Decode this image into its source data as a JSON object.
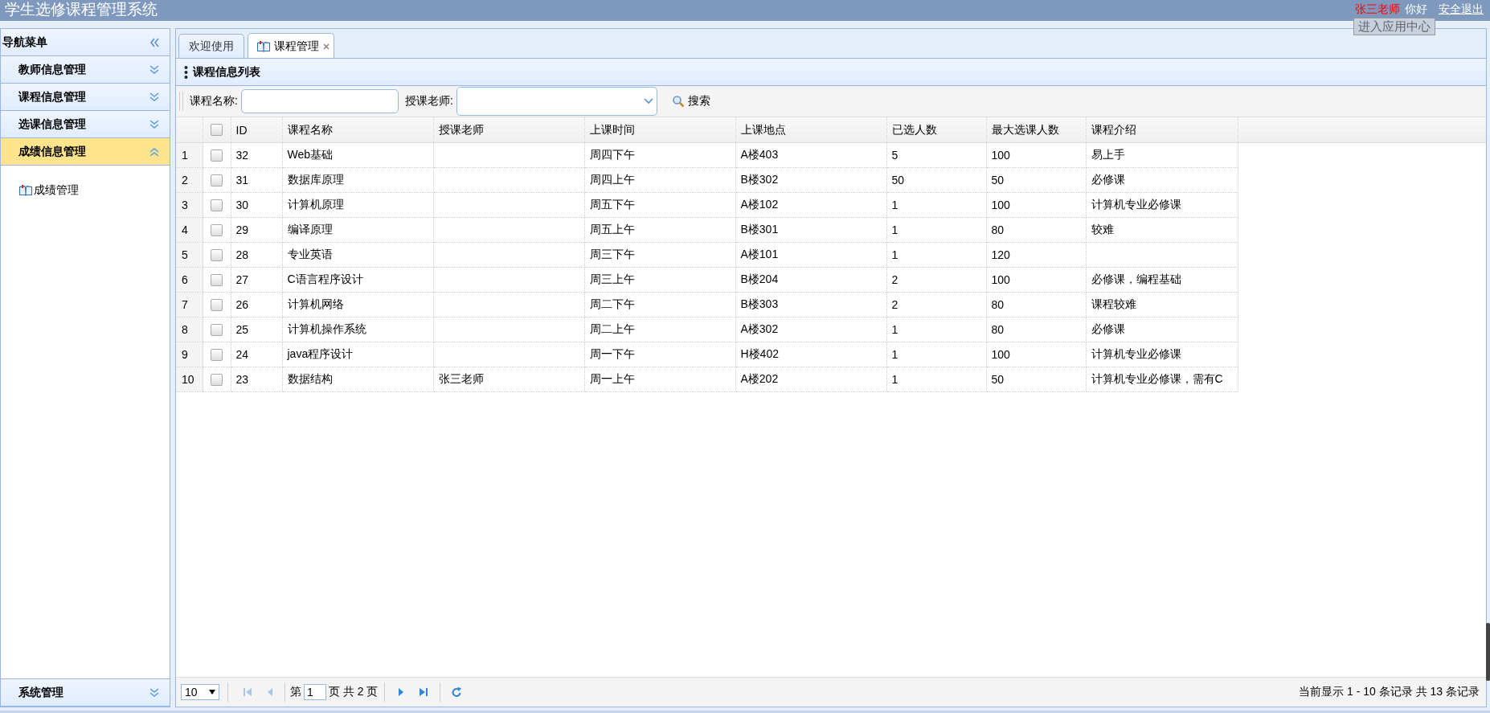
{
  "header": {
    "title": "学生选修课程管理系统",
    "user": "张三老师",
    "greeting": "你好",
    "logout": "安全退出",
    "tooltip": "进入应用中心"
  },
  "sidebar": {
    "title": "导航菜单",
    "items": [
      {
        "label": "教师信息管理",
        "selected": false,
        "expanded": false
      },
      {
        "label": "课程信息管理",
        "selected": false,
        "expanded": false
      },
      {
        "label": "选课信息管理",
        "selected": false,
        "expanded": false
      },
      {
        "label": "成绩信息管理",
        "selected": true,
        "expanded": true,
        "children": [
          {
            "label": "成绩管理"
          }
        ]
      },
      {
        "label": "系统管理",
        "selected": false,
        "expanded": false
      }
    ]
  },
  "tabs": [
    {
      "label": "欢迎使用",
      "selected": false,
      "closable": false
    },
    {
      "label": "课程管理",
      "selected": true,
      "closable": true
    }
  ],
  "panel": {
    "title": "课程信息列表"
  },
  "search": {
    "name_label": "课程名称:",
    "teacher_label": "授课老师:",
    "button": "搜索"
  },
  "table": {
    "header_checked": false,
    "columns": [
      "ID",
      "课程名称",
      "授课老师",
      "上课时间",
      "上课地点",
      "已选人数",
      "最大选课人数",
      "课程介绍"
    ],
    "rows": [
      {
        "number": "1",
        "checked": false,
        "cells": [
          "32",
          "Web基础",
          null,
          "周四下午",
          "A楼403",
          "5",
          "100",
          "易上手"
        ]
      },
      {
        "number": "2",
        "checked": false,
        "cells": [
          "31",
          "数据库原理",
          null,
          "周四上午",
          "B楼302",
          "50",
          "50",
          "必修课"
        ]
      },
      {
        "number": "3",
        "checked": false,
        "cells": [
          "30",
          "计算机原理",
          null,
          "周五下午",
          "A楼102",
          "1",
          "100",
          "计算机专业必修课"
        ]
      },
      {
        "number": "4",
        "checked": false,
        "cells": [
          "29",
          "编译原理",
          null,
          "周五上午",
          "B楼301",
          "1",
          "80",
          "较难"
        ]
      },
      {
        "number": "5",
        "checked": false,
        "cells": [
          "28",
          "专业英语",
          null,
          "周三下午",
          "A楼101",
          "1",
          "120",
          null
        ]
      },
      {
        "number": "6",
        "checked": false,
        "cells": [
          "27",
          "C语言程序设计",
          null,
          "周三上午",
          "B楼204",
          "2",
          "100",
          "必修课，编程基础"
        ]
      },
      {
        "number": "7",
        "checked": false,
        "cells": [
          "26",
          "计算机网络",
          null,
          "周二下午",
          "B楼303",
          "2",
          "80",
          "课程较难"
        ]
      },
      {
        "number": "8",
        "checked": false,
        "cells": [
          "25",
          "计算机操作系统",
          null,
          "周二上午",
          "A楼302",
          "1",
          "80",
          "必修课"
        ]
      },
      {
        "number": "9",
        "checked": false,
        "cells": [
          "24",
          "java程序设计",
          null,
          "周一下午",
          "H楼402",
          "1",
          "100",
          "计算机专业必修课"
        ]
      },
      {
        "number": "10",
        "checked": false,
        "cells": [
          "23",
          "数据结构",
          "张三老师",
          "周一上午",
          "A楼202",
          "1",
          "50",
          "计算机专业必修课，需有C"
        ]
      }
    ]
  },
  "pager": {
    "page_size": "10",
    "page_prefix": "第",
    "page": "1",
    "page_suffix": "页 共 2 页",
    "info": "当前显示 1 - 10 条记录 共 13 条记录"
  }
}
